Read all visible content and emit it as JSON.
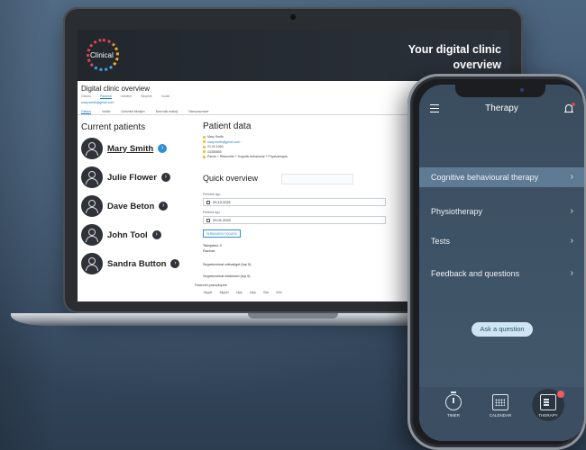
{
  "laptop": {
    "logo_text": "Clinical",
    "banner_title": "Your digital clinic overview",
    "app_heading": "Digital clinic overview",
    "top_tabs": [
      "Glavno",
      "Pacienti",
      "Vsebine",
      "Skupine",
      "Vodiči"
    ],
    "user_email": "mary.smith@gmail.com",
    "sub_tabs": [
      "Glavno",
      "Vodiči",
      "Dnevniki študijev",
      "Dnevniki reakcij",
      "Samozaznave"
    ],
    "current_patients_title": "Current patients",
    "patients": [
      {
        "name": "Mary Smith",
        "selected": true
      },
      {
        "name": "Julie Flower",
        "selected": false
      },
      {
        "name": "Dave Beton",
        "selected": false
      },
      {
        "name": "John Tool",
        "selected": false
      },
      {
        "name": "Sandra Button",
        "selected": false
      }
    ],
    "patient_data_title": "Patient data",
    "patient_details": {
      "name": "Mary Smith",
      "email": "mary.smith@gmail.com",
      "date": "21.02.1963",
      "phone": "03355555",
      "path": "Pacrik + Ritanorirto + Kognitiv behavioral + Physioterapia"
    },
    "quick_overview_title": "Quick overview",
    "start_label": "Pričetek dgo",
    "start_date": "20.10.2021",
    "end_label": "Pertired dgo",
    "end_date": "20.01.2022",
    "show_button": "SHRANJENI PODATKI",
    "stats": [
      "Taknjalesi: 0",
      "Racinal:",
      "Segrebovimal odkvaliget (top 5)",
      "Segrebovimal imkbimed (top 5)"
    ],
    "legend_title": "Pacionel pravodopeti",
    "legend": [
      "Alpper",
      "Allpper",
      "Llipp",
      "Llipp",
      "Volo",
      "Velo"
    ]
  },
  "phone": {
    "title": "Therapy",
    "menu": [
      {
        "label": "Cognitive behavioural therapy",
        "active": true
      },
      {
        "label": "Physiotherapy",
        "active": false
      },
      {
        "label": "Tests",
        "active": false
      },
      {
        "label": "Feedback and questions",
        "active": false
      }
    ],
    "ask_button": "Ask a question",
    "tabs": [
      {
        "label": "TIMER",
        "icon": "timer-icon"
      },
      {
        "label": "CALENDAR",
        "icon": "calendar-icon"
      },
      {
        "label": "THERAPY",
        "icon": "clipboard-icon",
        "active": true
      }
    ],
    "colors": {
      "accent": "#2d8fd5",
      "badge": "#ef5b62",
      "active_row": "#5f7a93"
    }
  }
}
